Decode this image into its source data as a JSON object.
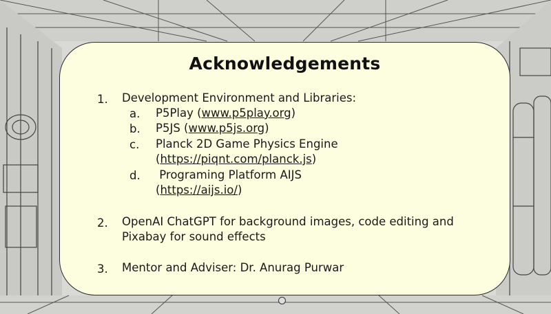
{
  "title": "Acknowledgements",
  "items": [
    {
      "number": "1.",
      "text": "Development Environment and Libraries:",
      "subitems": [
        {
          "letter": "a.",
          "text": "P5Play (",
          "link": "www.p5play.org",
          "after": ")"
        },
        {
          "letter": "b.",
          "text": "P5JS (",
          "link": "www.p5js.org",
          "after": ")"
        },
        {
          "letter": "c.",
          "text": "Planck 2D Game Physics Engine",
          "line2_pre": "(",
          "link": "https://piqnt.com/planck.js",
          "after": ")"
        },
        {
          "letter": "d.",
          "text": " Programing Platform AIJS",
          "line2_pre": "(",
          "link": "https://aijs.io/",
          "after": ")"
        }
      ]
    },
    {
      "number": "2.",
      "line1": "OpenAI ChatGPT for background images, code editing and",
      "line2": "Pixabay for sound effects"
    },
    {
      "number": "3.",
      "text": "Mentor and Adviser: Dr. Anurag Purwar"
    }
  ]
}
